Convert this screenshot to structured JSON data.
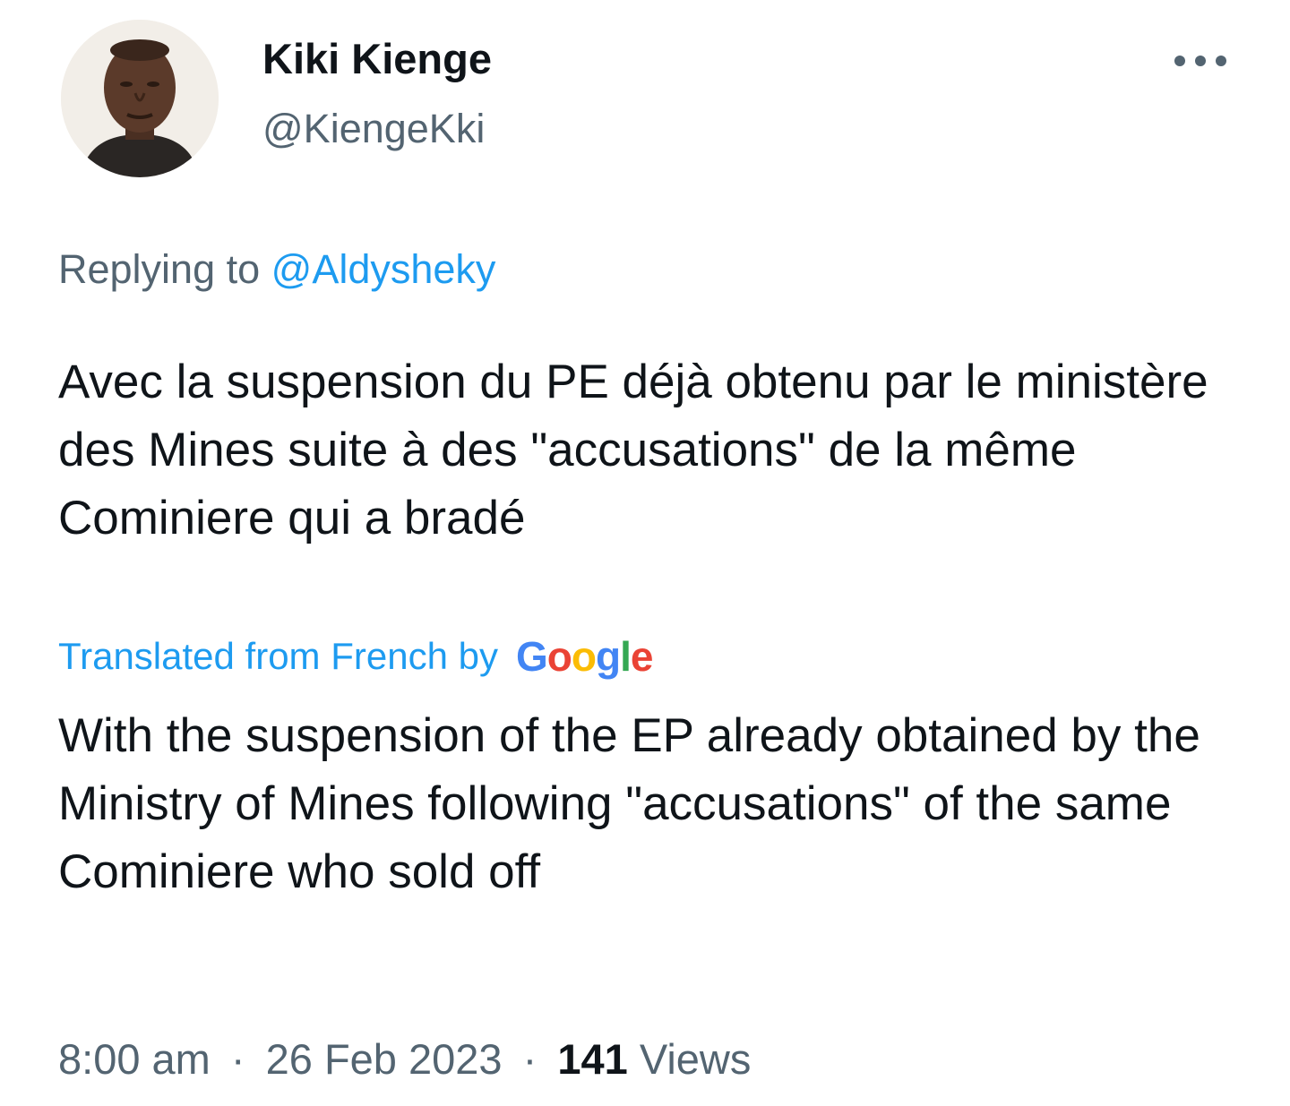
{
  "author": {
    "display_name": "Kiki Kienge",
    "handle": "@KiengeKki",
    "avatar_icon": "profile-photo"
  },
  "more_icon": "more-horizontal-icon",
  "reply": {
    "prefix": "Replying to",
    "to_handle": "@Aldysheky"
  },
  "tweet": {
    "original_text": "Avec la suspension du PE déjà obtenu par le ministère des Mines suite à des \"accusations\" de la même Cominiere qui a bradé",
    "translated_label": "Translated from French by",
    "translator": "Google",
    "translated_text": "With the suspension of the EP already obtained by the Ministry of Mines following \"accusations\" of the same Cominiere who sold off"
  },
  "meta": {
    "time": "8:00 am",
    "separator": "·",
    "date": "26 Feb 2023",
    "views_count": "141",
    "views_label": "Views"
  },
  "colors": {
    "link": "#1d9bf0",
    "secondary_text": "#536471",
    "primary_text": "#0f1419",
    "google_blue": "#4285F4",
    "google_red": "#EA4335",
    "google_yellow": "#FBBC05",
    "google_green": "#34A853"
  }
}
